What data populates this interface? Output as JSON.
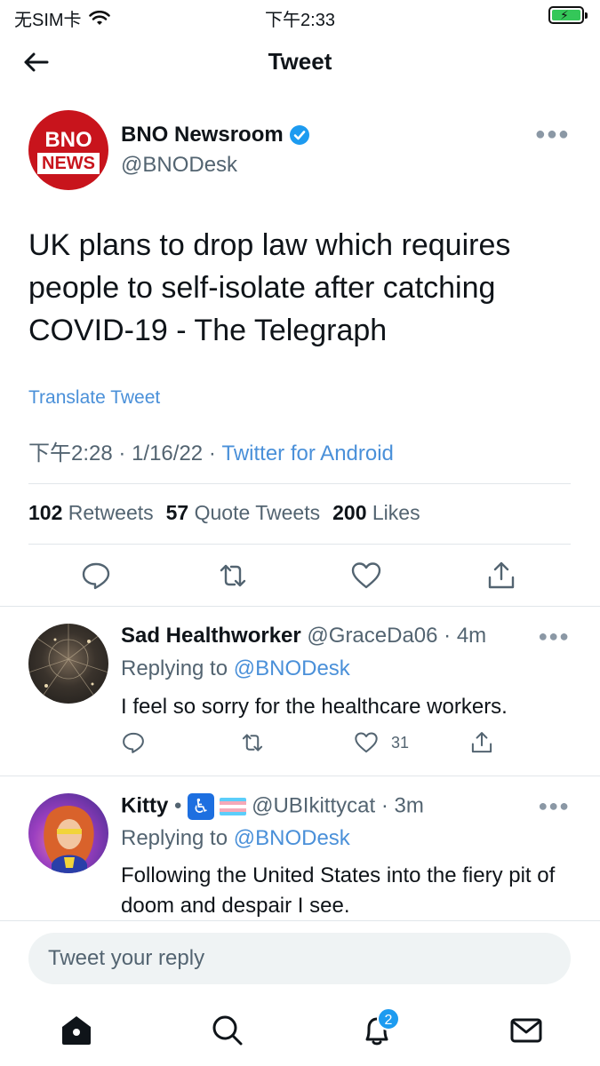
{
  "status_bar": {
    "carrier": "无SIM卡",
    "time": "下午2:33"
  },
  "header": {
    "title": "Tweet"
  },
  "main_tweet": {
    "avatar_line1": "BNO",
    "avatar_line2": "NEWS",
    "author_name": "BNO Newsroom",
    "author_handle": "@BNODesk",
    "text": "UK plans to drop law which requires people to self-isolate after catching COVID-19 - The Telegraph",
    "translate_label": "Translate Tweet",
    "timestamp": "下午2:28",
    "date": "1/16/22",
    "source": "Twitter for Android",
    "stats": {
      "retweets_count": "102",
      "retweets_label": "Retweets",
      "quotes_count": "57",
      "quotes_label": "Quote Tweets",
      "likes_count": "200",
      "likes_label": "Likes"
    }
  },
  "replies": [
    {
      "name": "Sad Healthworker",
      "handle": "@GraceDa06",
      "age": "4m",
      "replying_prefix": "Replying to",
      "replying_to": "@BNODesk",
      "text": "I feel so sorry for the healthcare workers.",
      "like_count": "31"
    },
    {
      "name": "Kitty",
      "name_sep": "•",
      "handle": "@UBIkittycat",
      "age": "3m",
      "replying_prefix": "Replying to",
      "replying_to": "@BNODesk",
      "text": "Following the United States into the fiery pit of doom and despair I see."
    }
  ],
  "compose": {
    "placeholder": "Tweet your reply"
  },
  "tabbar": {
    "notifications_badge": "2"
  },
  "colors": {
    "accent": "#1d9bf0",
    "link": "#4a90d9",
    "brand_red": "#c8141c",
    "secondary_text": "#536471"
  },
  "icons": [
    "back-arrow-icon",
    "verified-icon",
    "more-icon",
    "reply-icon",
    "retweet-icon",
    "like-icon",
    "share-icon",
    "home-icon",
    "search-icon",
    "notifications-icon",
    "messages-icon",
    "wifi-icon",
    "battery-icon",
    "accessibility-icon",
    "trans-flag-icon"
  ]
}
